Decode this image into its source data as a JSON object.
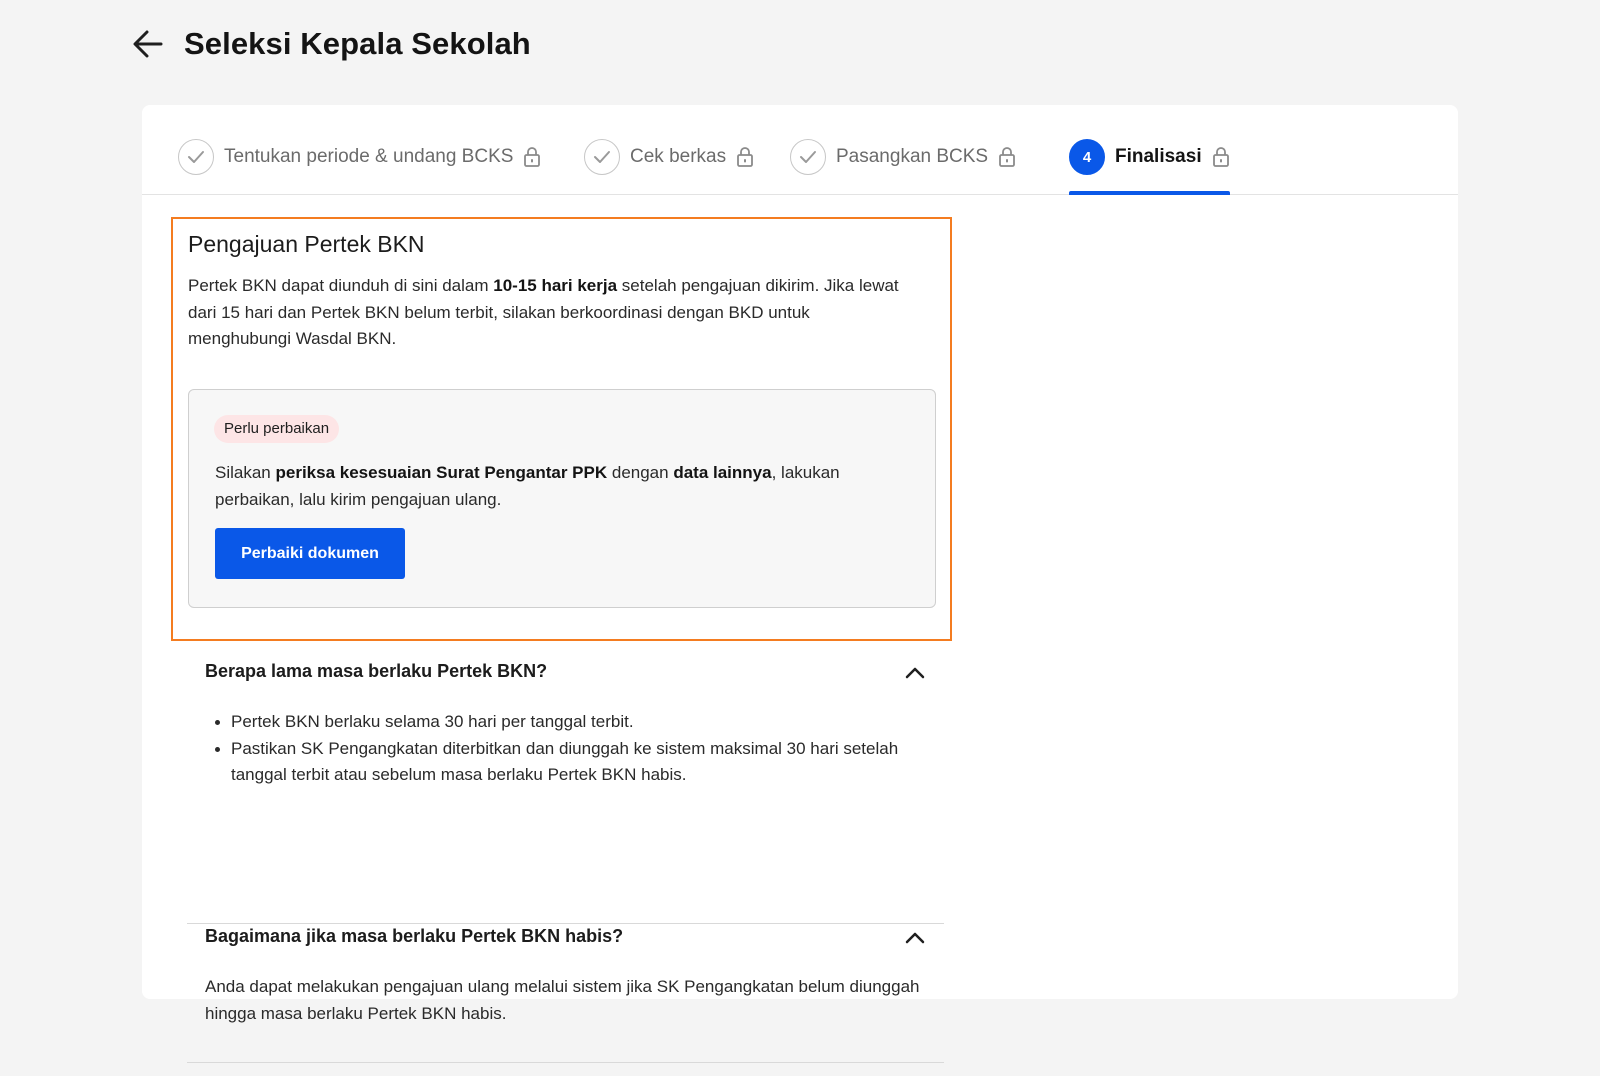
{
  "header": {
    "title": "Seleksi Kepala Sekolah"
  },
  "stepper": {
    "steps": [
      {
        "label": "Tentukan periode & undang BCKS",
        "state": "done"
      },
      {
        "label": "Cek berkas",
        "state": "done"
      },
      {
        "label": "Pasangkan BCKS",
        "state": "done"
      },
      {
        "label": "Finalisasi",
        "state": "active",
        "number": "4"
      }
    ]
  },
  "section": {
    "title": "Pengajuan Pertek BKN",
    "desc_part1": "Pertek BKN dapat diunduh di sini dalam ",
    "desc_bold": "10-15 hari kerja",
    "desc_part2": " setelah pengajuan dikirim. Jika lewat dari 15 hari dan Pertek BKN belum terbit, silakan berkoordinasi dengan BKD untuk menghubungi Wasdal BKN."
  },
  "notice": {
    "badge": "Perlu perbaikan",
    "text_part1": "Silakan ",
    "text_bold1": "periksa kesesuaian Surat Pengantar PPK",
    "text_part2": " dengan ",
    "text_bold2": "data lainnya",
    "text_part3": ", lakukan perbaikan, lalu kirim pengajuan ulang.",
    "button": "Perbaiki dokumen"
  },
  "faq": [
    {
      "question": "Berapa lama masa berlaku Pertek BKN?",
      "items": [
        "Pertek BKN berlaku selama 30 hari per tanggal terbit.",
        "Pastikan SK Pengangkatan diterbitkan dan diunggah ke sistem maksimal 30 hari setelah tanggal terbit atau sebelum masa berlaku Pertek BKN habis."
      ]
    },
    {
      "question": "Bagaimana jika masa berlaku Pertek BKN habis?",
      "answer": "Anda dapat melakukan pengajuan ulang melalui sistem jika SK Pengangkatan belum diunggah hingga masa berlaku Pertek BKN habis."
    }
  ],
  "colors": {
    "primary": "#0a58e8",
    "highlight": "#f47c20",
    "badge_bg": "#fde5e6"
  }
}
